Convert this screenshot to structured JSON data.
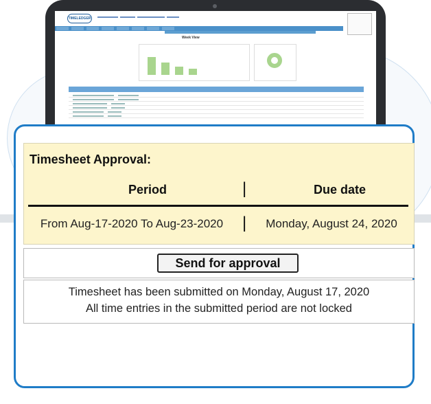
{
  "background_screen": {
    "logo_text": "TIMELEDGER",
    "view_title": "Week View"
  },
  "approval": {
    "title": "Timesheet Approval:",
    "period_header": "Period",
    "due_header": "Due date",
    "separator": "|",
    "period_value": "From Aug-17-2020 To Aug-23-2020",
    "due_value": "Monday, August 24, 2020"
  },
  "actions": {
    "send_label": "Send for approval"
  },
  "status": {
    "line1": "Timesheet has been submitted on Monday, August 17, 2020",
    "line2": "All time entries in the submitted period are not locked"
  },
  "colors": {
    "accent": "#1f7cc7",
    "approval_bg": "#fdf5cc"
  }
}
